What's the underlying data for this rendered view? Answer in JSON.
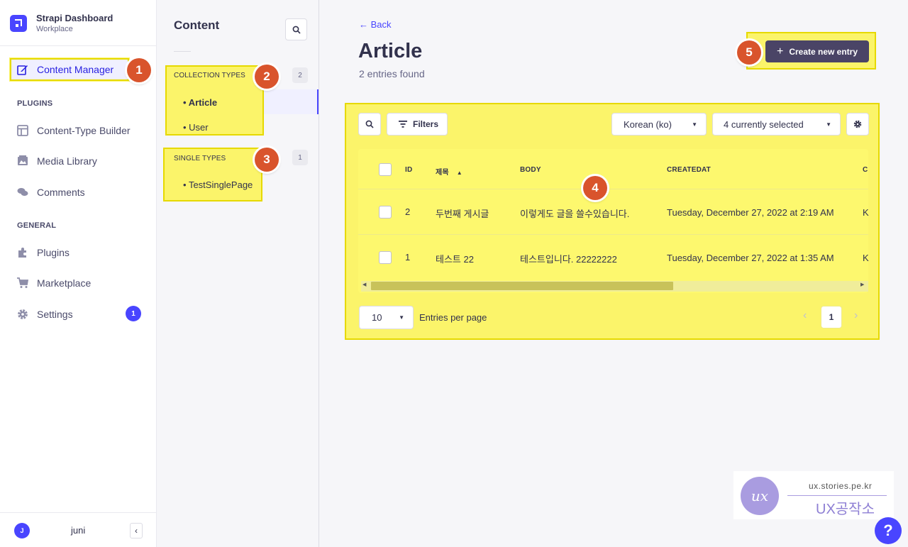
{
  "brand": {
    "title": "Strapi Dashboard",
    "subtitle": "Workplace"
  },
  "sidebar": {
    "content_manager": "Content Manager",
    "plugins_heading": "PLUGINS",
    "plugins": [
      "Content-Type Builder",
      "Media Library",
      "Comments"
    ],
    "general_heading": "GENERAL",
    "general": [
      "Plugins",
      "Marketplace",
      "Settings"
    ],
    "settings_badge": "1",
    "user_initial": "J",
    "user_name": "juni",
    "collapse_glyph": "‹"
  },
  "subnav": {
    "title": "Content",
    "collection_label": "COLLECTION TYPES",
    "collection_count": "2",
    "collection_items": [
      "Article",
      "User"
    ],
    "single_label": "SINGLE TYPES",
    "single_count": "1",
    "single_items": [
      "TestSinglePage"
    ]
  },
  "main": {
    "back": "← Back",
    "title": "Article",
    "subtitle": "2 entries found",
    "create_plus": "+",
    "create_label": "Create new entry",
    "filters_label": "Filters",
    "locale": "Korean (ko)",
    "columns_selected": "4 currently selected",
    "table": {
      "headers": [
        "ID",
        "제목",
        "BODY",
        "CREATEDAT",
        "C"
      ],
      "sort_indicator": "▲",
      "rows": [
        {
          "id": "2",
          "title": "두번째 게시글",
          "body": "이렇게도 글을 쓸수있습니다.",
          "created": "Tuesday, December 27, 2022 at 2:19 AM",
          "extra": "K"
        },
        {
          "id": "1",
          "title": "테스트 22",
          "body": "테스트입니다. 22222222",
          "created": "Tuesday, December 27, 2022 at 1:35 AM",
          "extra": "K"
        }
      ]
    },
    "page_size": "10",
    "entries_per_page": "Entries per page",
    "prev_glyph": "‹",
    "current_page": "1",
    "next_glyph": "›"
  },
  "markers": [
    "1",
    "2",
    "3",
    "4",
    "5"
  ],
  "watermark": {
    "url": "ux.stories.pe.kr",
    "name": "UX공작소",
    "logo_text": "ux"
  },
  "help": "?",
  "colors": {
    "primary": "#4945ff",
    "highlight": "#fbf46a",
    "marker": "#d9542c",
    "dark_button": "#4a4466"
  }
}
